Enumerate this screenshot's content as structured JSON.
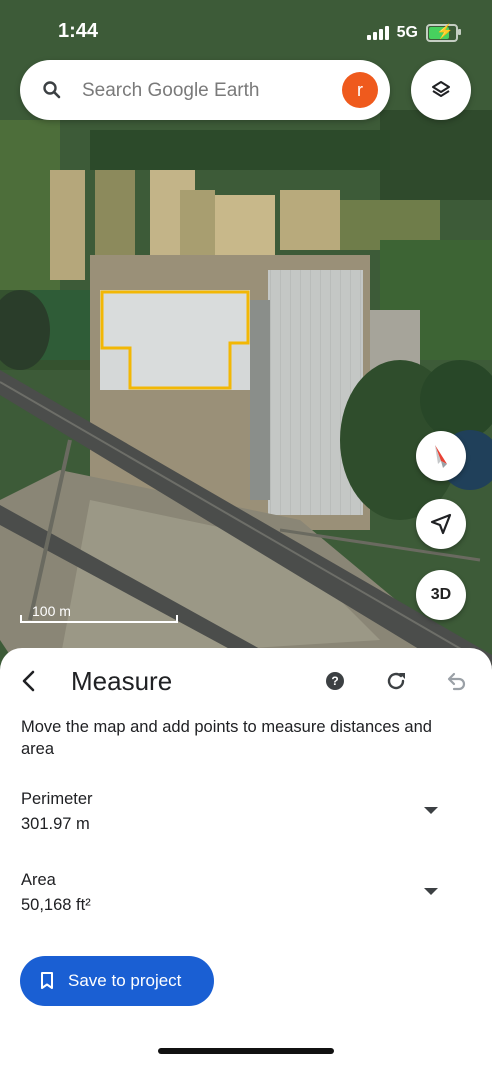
{
  "status_bar": {
    "time": "1:44",
    "network": "5G"
  },
  "search": {
    "placeholder": "Search Google Earth",
    "avatar_letter": "r"
  },
  "map_controls": {
    "three_d_label": "3D",
    "scale_label": "100 m"
  },
  "measure_panel": {
    "title": "Measure",
    "help_glyph": "?",
    "description": "Move the map and add points to measure distances and area",
    "perimeter": {
      "label": "Perimeter",
      "value": "301.97 m"
    },
    "area": {
      "label": "Area",
      "value": "50,168 ft²"
    },
    "save_button_label": "Save to project"
  },
  "icons": [
    "search-icon",
    "layers-icon",
    "compass-icon",
    "location-arrow-icon",
    "back-chevron-icon",
    "help-icon",
    "refresh-icon",
    "undo-icon",
    "bookmark-icon",
    "dropdown-icon"
  ],
  "colors": {
    "avatar": "#ef5a1d",
    "save_button": "#1a5fd3",
    "measure_outline": "#f2b705"
  }
}
